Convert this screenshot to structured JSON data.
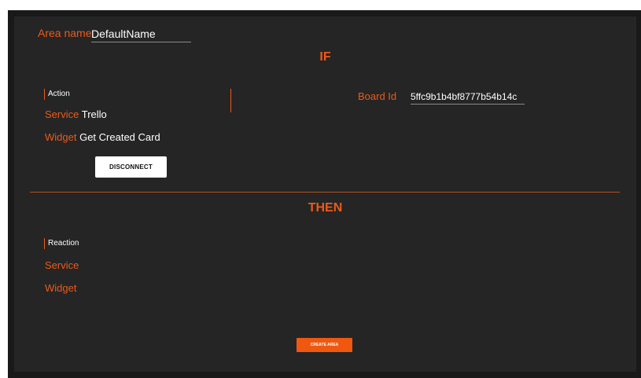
{
  "area": {
    "name_label": "Area name",
    "name_value": "DefaultName"
  },
  "if_section": {
    "title": "IF",
    "kind_label": "Action",
    "service_label": "Service",
    "service_value": "Trello",
    "widget_label": "Widget",
    "widget_value": "Get Created Card",
    "disconnect_label": "DISCONNECT",
    "board_id_label": "Board Id",
    "board_id_value": "5ffc9b1b4bf8777b54b14c"
  },
  "then_section": {
    "title": "THEN",
    "kind_label": "Reaction",
    "service_label": "Service",
    "widget_label": "Widget"
  },
  "create_area_label": "CREATE AREA",
  "colors": {
    "accent": "#ec5a1a",
    "background": "#252525",
    "frame": "#191919"
  }
}
